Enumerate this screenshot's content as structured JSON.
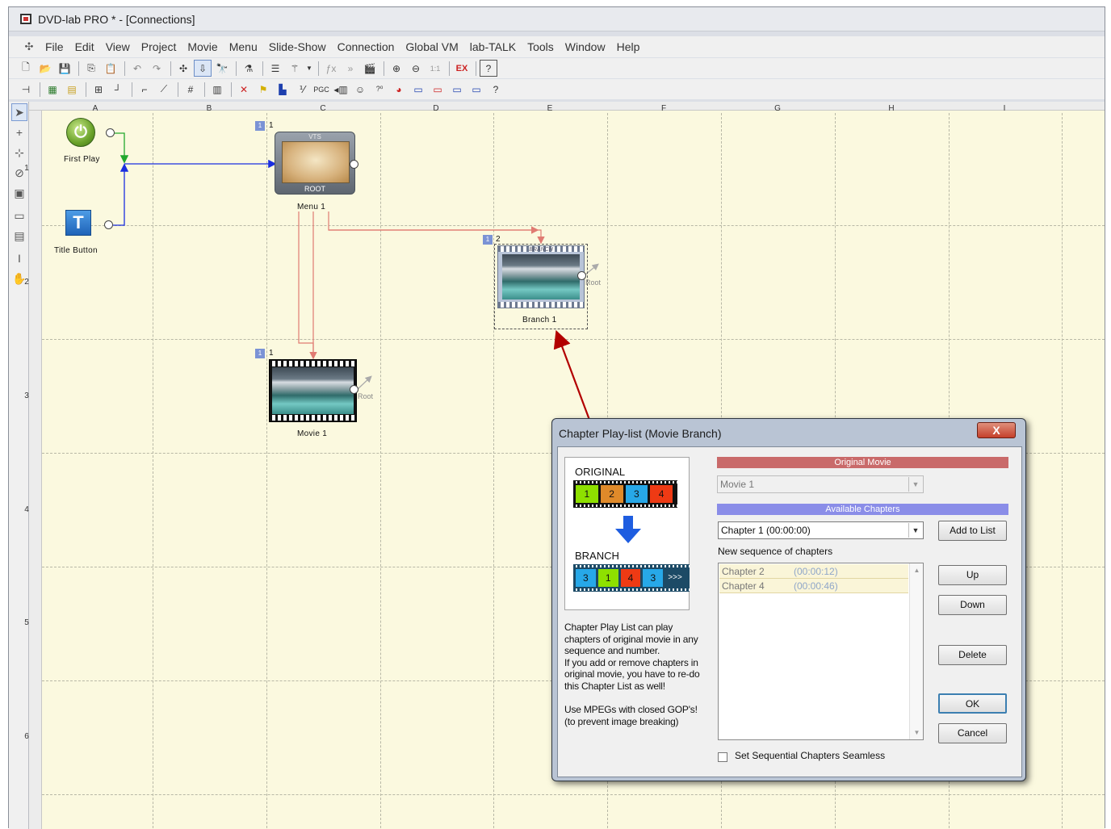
{
  "window": {
    "title": "DVD-lab PRO * - [Connections]"
  },
  "menu": [
    "File",
    "Edit",
    "View",
    "Project",
    "Movie",
    "Menu",
    "Slide-Show",
    "Connection",
    "Global VM",
    "lab-TALK",
    "Tools",
    "Window",
    "Help"
  ],
  "toolbar": {
    "icon_labels": {
      "pgc": "PGC",
      "one_to_one": "1:1",
      "pro_ex": "EX"
    }
  },
  "grid": {
    "columns": [
      "A",
      "B",
      "C",
      "D",
      "E",
      "F",
      "G",
      "H",
      "I"
    ],
    "rows": [
      "1",
      "2",
      "3",
      "4",
      "5",
      "6"
    ]
  },
  "nodes": {
    "first_play": {
      "label": "First Play"
    },
    "title_button": {
      "label": "Title Button",
      "icon": "T"
    },
    "menu1": {
      "label": "Menu 1",
      "vts": "VTS",
      "root": "ROOT",
      "badge": "1",
      "number": "1"
    },
    "branch1": {
      "label": "Branch 1",
      "tag": "BRANCH",
      "badge": "1",
      "number": "2",
      "root": "Root"
    },
    "movie1": {
      "label": "Movie 1",
      "badge": "1",
      "number": "1",
      "root": "Root"
    }
  },
  "dialog": {
    "title": "Chapter Play-list (Movie Branch)",
    "close": "X",
    "illustration": {
      "original_label": "ORIGINAL",
      "original_cells": [
        "1",
        "2",
        "3",
        "4"
      ],
      "branch_label": "BRANCH",
      "branch_cells": [
        "3",
        "1",
        "4",
        "3",
        ">>>"
      ]
    },
    "help_text": "Chapter Play List can play chapters of original movie in any sequence and number.\nIf you add or remove chapters in original movie, you have to re-do this Chapter List as well!\n\nUse MPEGs with closed GOP's!\n   (to prevent image breaking)",
    "original_movie_header": "Original Movie",
    "movie_select": "Movie 1",
    "available_chapters_header": "Available Chapters",
    "chapter_select": "Chapter 1 (00:00:00)",
    "add_to_list": "Add to List",
    "new_sequence_label": "New sequence of chapters",
    "sequence": [
      {
        "name": "Chapter 2",
        "time": "(00:00:12)"
      },
      {
        "name": "Chapter 4",
        "time": "(00:00:46)"
      }
    ],
    "up": "Up",
    "down": "Down",
    "delete": "Delete",
    "ok": "OK",
    "cancel": "Cancel",
    "seamless_label": "Set Sequential Chapters Seamless",
    "seamless_checked": false
  },
  "colors": {
    "canvas": "#fbf9df",
    "wire_blue": "#1a2ee0",
    "wire_pink": "#e07b72",
    "annotation_red": "#b20000",
    "header_red": "#c96a6a",
    "header_blue": "#8a8de8"
  }
}
